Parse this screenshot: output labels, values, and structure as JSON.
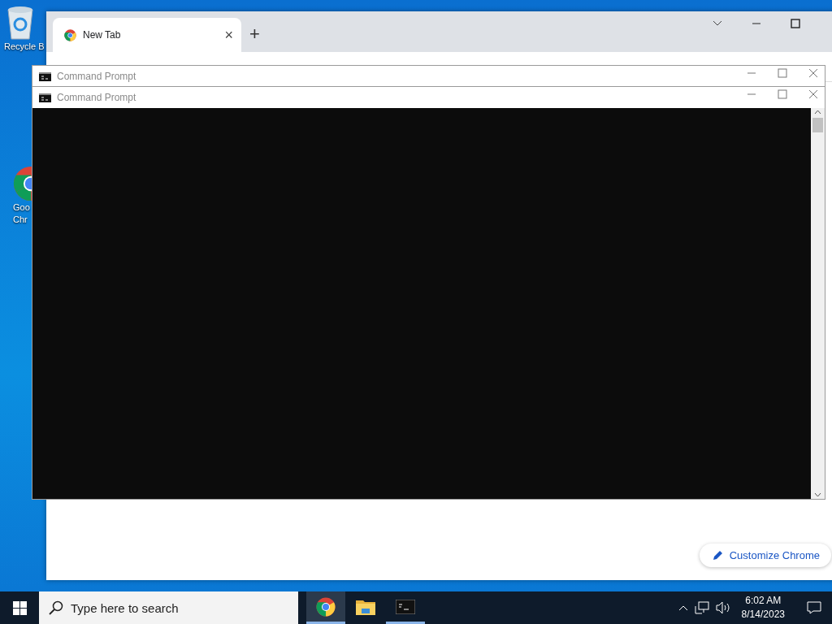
{
  "desktop_icons": [
    {
      "kind": "bin",
      "lines": [
        "Recycle B"
      ]
    },
    {
      "kind": "chrome",
      "lines": [
        "Goo",
        "Chr"
      ]
    }
  ],
  "browser": {
    "tab": {
      "title": "New Tab",
      "close": "×"
    },
    "new_tab": "+",
    "customize": "Customize Chrome"
  },
  "cmd_windows": [
    {
      "title": "Command Prompt"
    },
    {
      "title": "Command Prompt"
    }
  ],
  "taskbar": {
    "search": {
      "placeholder": "Type here to search"
    },
    "apps": [
      {
        "kind": "chrome",
        "selected": true,
        "running": true
      },
      {
        "kind": "explorer",
        "selected": false,
        "running": false
      },
      {
        "kind": "cmd",
        "selected": false,
        "running": true
      }
    ],
    "time": "6:02 AM",
    "date": "8/14/2023"
  }
}
